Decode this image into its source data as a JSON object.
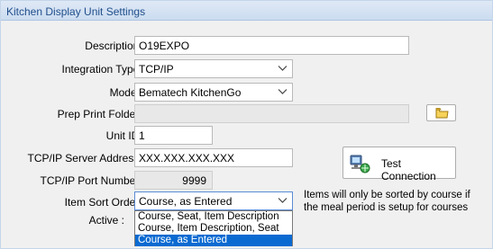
{
  "panel": {
    "title": "Kitchen Display Unit Settings"
  },
  "fields": {
    "description": {
      "label": "Description :",
      "value": "O19EXPO"
    },
    "integration_type": {
      "label": "Integration Type :",
      "value": "TCP/IP"
    },
    "model": {
      "label": "Model :",
      "value": "Bematech KitchenGo"
    },
    "prep_print_folder": {
      "label": "Prep Print Folder :",
      "value": ""
    },
    "unit_id": {
      "label": "Unit ID :",
      "value": "1"
    },
    "server_address": {
      "label": "TCP/IP Server Address :",
      "value": "XXX.XXX.XXX.XXX"
    },
    "port_number": {
      "label": "TCP/IP Port Number :",
      "value": "9999"
    },
    "item_sort_order": {
      "label": "Item Sort Order :",
      "value": "Course, as Entered",
      "options": [
        "Course, Seat, Item Description",
        "Course, Item Description, Seat",
        "Course, as Entered"
      ],
      "selected_index": 2
    },
    "active": {
      "label": "Active :"
    }
  },
  "buttons": {
    "test_connection": "Test Connection",
    "browse_folder_icon": "folder-icon"
  },
  "note": "Items will only be sorted by course if the meal period is setup for courses",
  "colors": {
    "header_text": "#1f4e8c",
    "selection": "#0a6ad1"
  }
}
